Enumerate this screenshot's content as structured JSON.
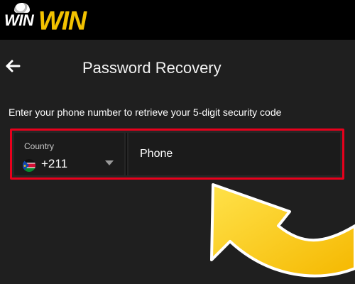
{
  "header": {
    "logo_small": "WIN",
    "logo_big": "WIN"
  },
  "page": {
    "title": "Password Recovery",
    "instruction": "Enter your phone number to retrieve your 5-digit security code"
  },
  "phone_form": {
    "country_label": "Country",
    "country_code": "+211",
    "phone_placeholder": "Phone"
  },
  "colors": {
    "background": "#1f1f1f",
    "topbar": "#000000",
    "brand_yellow": "#f2c200",
    "highlight_red": "#e8001c",
    "arrow_yellow": "#ffd200"
  },
  "icons": {
    "back": "arrow-left-icon",
    "flag": "south-sudan-flag-icon",
    "dropdown": "chevron-down-icon",
    "callout": "curved-arrow-icon"
  }
}
